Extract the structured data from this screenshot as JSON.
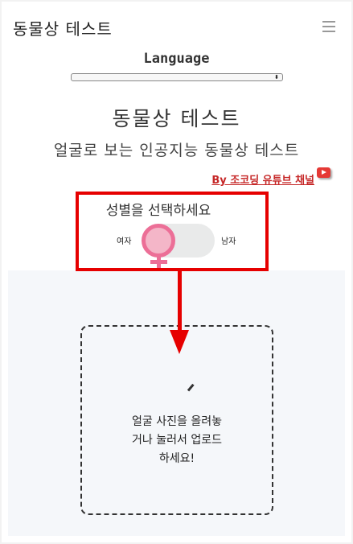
{
  "header": {
    "brand": "동물상 테스트",
    "menu_icon": "hamburger-icon"
  },
  "language": {
    "label": "Language",
    "selected": ""
  },
  "main": {
    "title": "동물상 테스트",
    "subtitle": "얼굴로 보는 인공지능 동물상 테스트",
    "channel_link": "By 조코딩 유튜브 채널",
    "channel_icon": "youtube-icon"
  },
  "gender": {
    "title": "성별을 선택하세요",
    "female_label": "여자",
    "male_label": "남자",
    "selected": "여자",
    "knob_icon": "venus-icon",
    "accent_color": "#ec6f97"
  },
  "upload": {
    "text_line1": "얼굴 사진을 올려놓",
    "text_line2": "거나 눌러서 업로드",
    "text_line3": "하세요!",
    "icon": "upload-icon"
  },
  "annotation": {
    "box_color": "#e60000",
    "arrow_color": "#e60000"
  }
}
